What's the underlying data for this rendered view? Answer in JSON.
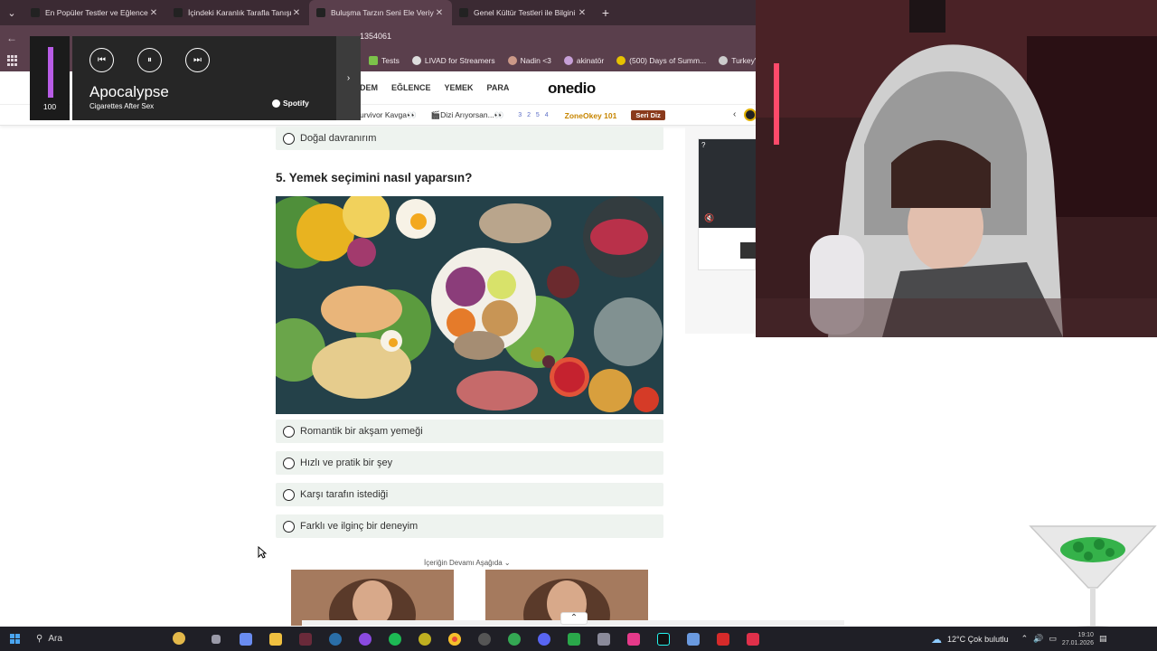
{
  "browser": {
    "tabs": [
      {
        "title": "En Popüler Testler ve Eğlenceli T",
        "active": false
      },
      {
        "title": "İçindeki Karanlık Tarafla Tanışmı",
        "active": false
      },
      {
        "title": "Buluşma Tarzın Seni Ele Veriyor",
        "active": true
      },
      {
        "title": "Genel Kültür Testleri ile Bilgini T",
        "active": false
      }
    ],
    "url_tail": "1354061",
    "bookmarks": [
      {
        "label": "Tests",
        "color": "#7cc24a"
      },
      {
        "label": "LIVAD for Streamers",
        "color": "#dddddd"
      },
      {
        "label": "Nadin <3",
        "color": "#c98"
      },
      {
        "label": "akinatör",
        "color": "#c7a0d8"
      },
      {
        "label": "(500) Days of Summ...",
        "color": "#e6c200"
      },
      {
        "label": "TurkeyVisited",
        "color": "#cccccc"
      }
    ]
  },
  "site": {
    "nav": [
      "DEM",
      "EĞLENCE",
      "YEMEK",
      "PARA"
    ],
    "logo": "onedio",
    "subnav": {
      "item1": "urvivor Kavga👀",
      "item2": "🎬Dizi Arıyorsan...👀",
      "grid_nums": "3 2 5 4",
      "zone": "ZoneOkey 101",
      "seri": "Seri Diz"
    }
  },
  "quiz": {
    "prev_answer": "Doğal davranırım",
    "question": "5. Yemek seçimini nasıl yaparsın?",
    "answers": [
      "Romantik bir akşam yemeği",
      "Hızlı ve pratik bir şey",
      "Karşı tarafın istediği",
      "Farklı ve ilginç bir deneyim"
    ],
    "continue_label": "İçeriğin Devamı Aşağıda ⌄"
  },
  "spotify": {
    "volume": 100,
    "volume_label": "100",
    "track": "Apocalypse",
    "artist": "Cigarettes After Sex",
    "brand": "Spotify"
  },
  "taskbar": {
    "search_placeholder": "Ara",
    "weather": "12°C  Çok bulutlu",
    "time": "19:10",
    "date": "27.01.2026"
  },
  "colors": {
    "tab_bar": "#3b2a33",
    "chrome": "#5a3f4c",
    "answer_bg": "#eef3ef",
    "spotify_accent": "#b85ce6"
  }
}
